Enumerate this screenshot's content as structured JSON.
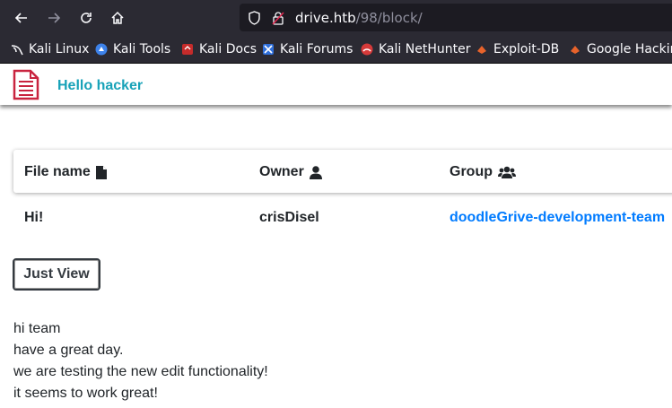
{
  "browser": {
    "url_host": "drive.htb",
    "url_path": "/98/block/",
    "bookmarks": [
      "Kali Linux",
      "Kali Tools",
      "Kali Docs",
      "Kali Forums",
      "Kali NetHunter",
      "Exploit-DB",
      "Google Hacking"
    ]
  },
  "app": {
    "brand": "Hello hacker",
    "columns": [
      "File name",
      "Owner",
      "Group"
    ],
    "row": {
      "file_name": "Hi!",
      "owner": "crisDisel",
      "group": "doodleGrive-development-team"
    },
    "button": "Just View",
    "content_lines": [
      "hi team",
      "have a great day.",
      "we are testing the new edit functionality!",
      "it seems to work great!"
    ]
  },
  "colors": {
    "brand": "#17a2b8",
    "link": "#007bff",
    "chrome": "#2b2a33"
  }
}
